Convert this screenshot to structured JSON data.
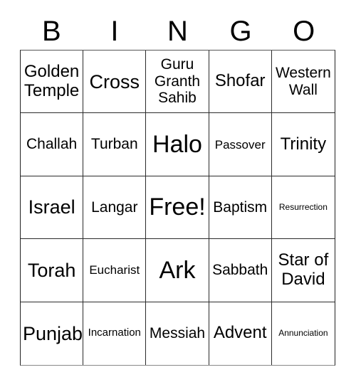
{
  "card": {
    "title": "BINGO",
    "header_letters": [
      "B",
      "I",
      "N",
      "G",
      "O"
    ],
    "columns": 5,
    "rows": 5,
    "text_color": "#000000",
    "background_color": "#ffffff",
    "border_color": "#2b2b2b",
    "free_space": "Free!",
    "cells": [
      {
        "label": "Golden\nTemple",
        "size": "l"
      },
      {
        "label": "Cross",
        "size": "xl"
      },
      {
        "label": "Guru\nGranth\nSahib",
        "size": "m"
      },
      {
        "label": "Shofar",
        "size": "l"
      },
      {
        "label": "Western\nWall",
        "size": "m"
      },
      {
        "label": "Challah",
        "size": "m"
      },
      {
        "label": "Turban",
        "size": "m"
      },
      {
        "label": "Halo",
        "size": "xxl"
      },
      {
        "label": "Passover",
        "size": "s"
      },
      {
        "label": "Trinity",
        "size": "l"
      },
      {
        "label": "Israel",
        "size": "xl"
      },
      {
        "label": "Langar",
        "size": "m"
      },
      {
        "label": "Free!",
        "size": "xxl"
      },
      {
        "label": "Baptism",
        "size": "m"
      },
      {
        "label": "Resurrection",
        "size": "xxs"
      },
      {
        "label": "Torah",
        "size": "xl"
      },
      {
        "label": "Eucharist",
        "size": "s"
      },
      {
        "label": "Ark",
        "size": "xxl"
      },
      {
        "label": "Sabbath",
        "size": "m"
      },
      {
        "label": "Star of\nDavid",
        "size": "l"
      },
      {
        "label": "Punjab",
        "size": "xl"
      },
      {
        "label": "Incarnation",
        "size": "xs"
      },
      {
        "label": "Messiah",
        "size": "m"
      },
      {
        "label": "Advent",
        "size": "l"
      },
      {
        "label": "Annunciation",
        "size": "xxs"
      }
    ]
  }
}
